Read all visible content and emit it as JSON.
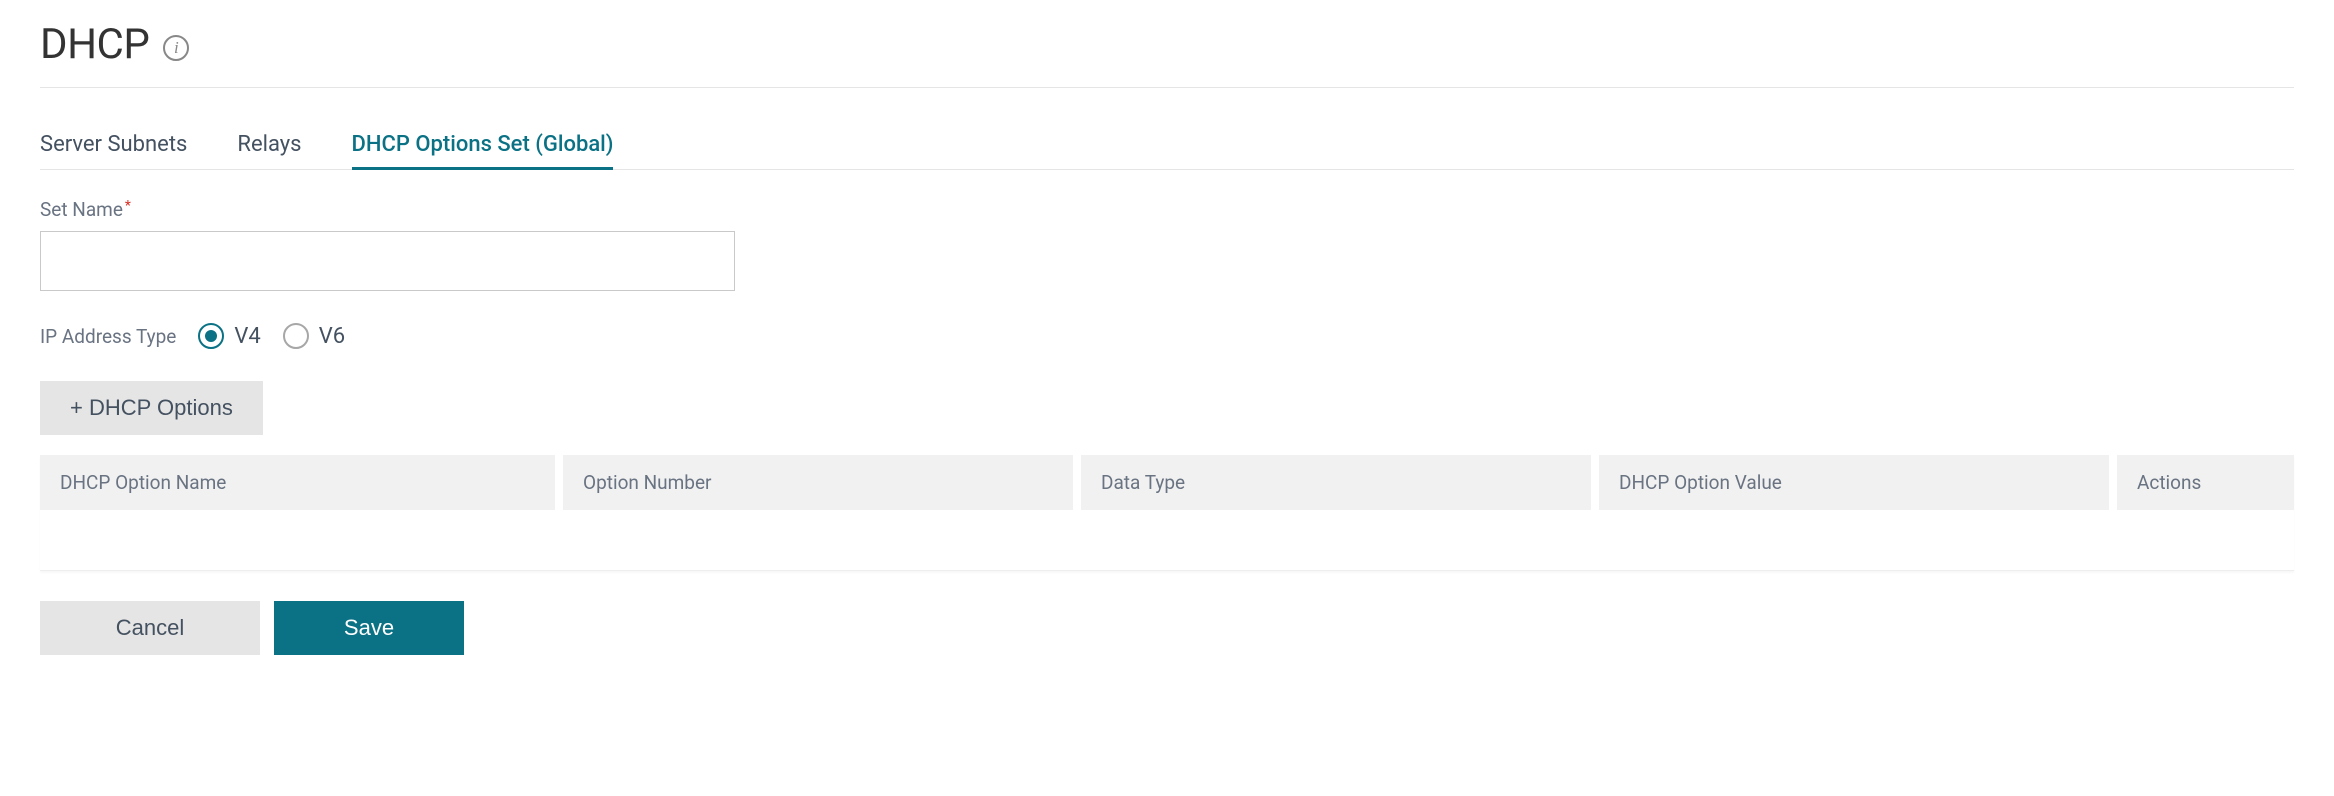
{
  "header": {
    "title": "DHCP"
  },
  "tabs": {
    "items": [
      {
        "label": "Server Subnets"
      },
      {
        "label": "Relays"
      },
      {
        "label": "DHCP Options Set (Global)"
      }
    ]
  },
  "form": {
    "set_name_label": "Set Name",
    "set_name_value": "",
    "ip_type_label": "IP Address Type",
    "radio_v4_label": "V4",
    "radio_v6_label": "V6",
    "add_options_label": "+ DHCP Options"
  },
  "table": {
    "headers": {
      "name": "DHCP Option Name",
      "number": "Option Number",
      "datatype": "Data Type",
      "value": "DHCP Option Value",
      "actions": "Actions"
    }
  },
  "buttons": {
    "cancel": "Cancel",
    "save": "Save"
  }
}
